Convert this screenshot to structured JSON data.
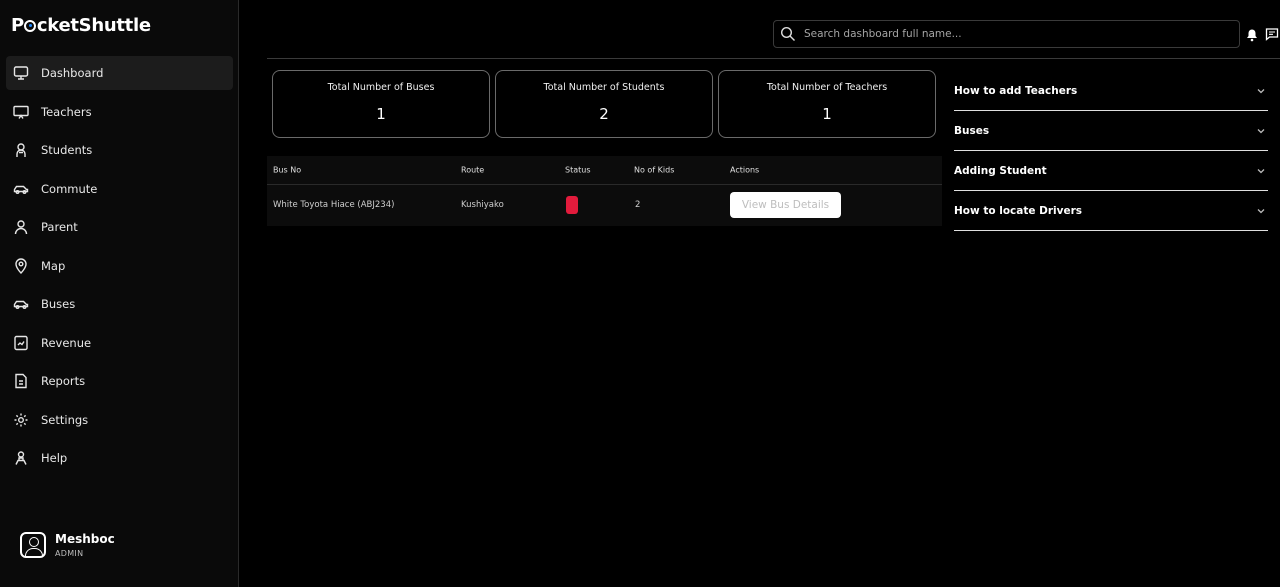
{
  "app": {
    "logo_p": "P",
    "logo_rest": "cketShuttle"
  },
  "sidebar": {
    "items": [
      {
        "label": "Dashboard",
        "icon": "monitor-icon",
        "active": true
      },
      {
        "label": "Teachers",
        "icon": "presentation-icon"
      },
      {
        "label": "Students",
        "icon": "student-icon"
      },
      {
        "label": "Commute",
        "icon": "car-icon"
      },
      {
        "label": "Parent",
        "icon": "person-icon"
      },
      {
        "label": "Map",
        "icon": "map-pin-icon"
      },
      {
        "label": "Buses",
        "icon": "bus-icon"
      },
      {
        "label": "Revenue",
        "icon": "revenue-chart-icon"
      },
      {
        "label": "Reports",
        "icon": "reports-icon"
      },
      {
        "label": "Settings",
        "icon": "gear-icon"
      },
      {
        "label": "Help",
        "icon": "help-icon"
      }
    ],
    "user": {
      "name": "Meshboc",
      "role": "ADMIN"
    }
  },
  "topbar": {
    "search_placeholder": "Search dashboard full name..."
  },
  "stats": [
    {
      "title": "Total Number of Buses",
      "value": "1"
    },
    {
      "title": "Total Number of Students",
      "value": "2"
    },
    {
      "title": "Total Number of Teachers",
      "value": "1"
    }
  ],
  "table": {
    "headers": [
      "Bus No",
      "Route",
      "Status",
      "No of Kids",
      "Actions"
    ],
    "rows": [
      {
        "bus_no": "White Toyota Hiace (ABJ234)",
        "route": "Kushiyako",
        "status_color": "#e21b3c",
        "kids": "2",
        "action_label": "View Bus Details"
      }
    ]
  },
  "faq": [
    {
      "label": "How to add Teachers"
    },
    {
      "label": "Buses"
    },
    {
      "label": "Adding Student"
    },
    {
      "label": "How to locate Drivers"
    }
  ]
}
